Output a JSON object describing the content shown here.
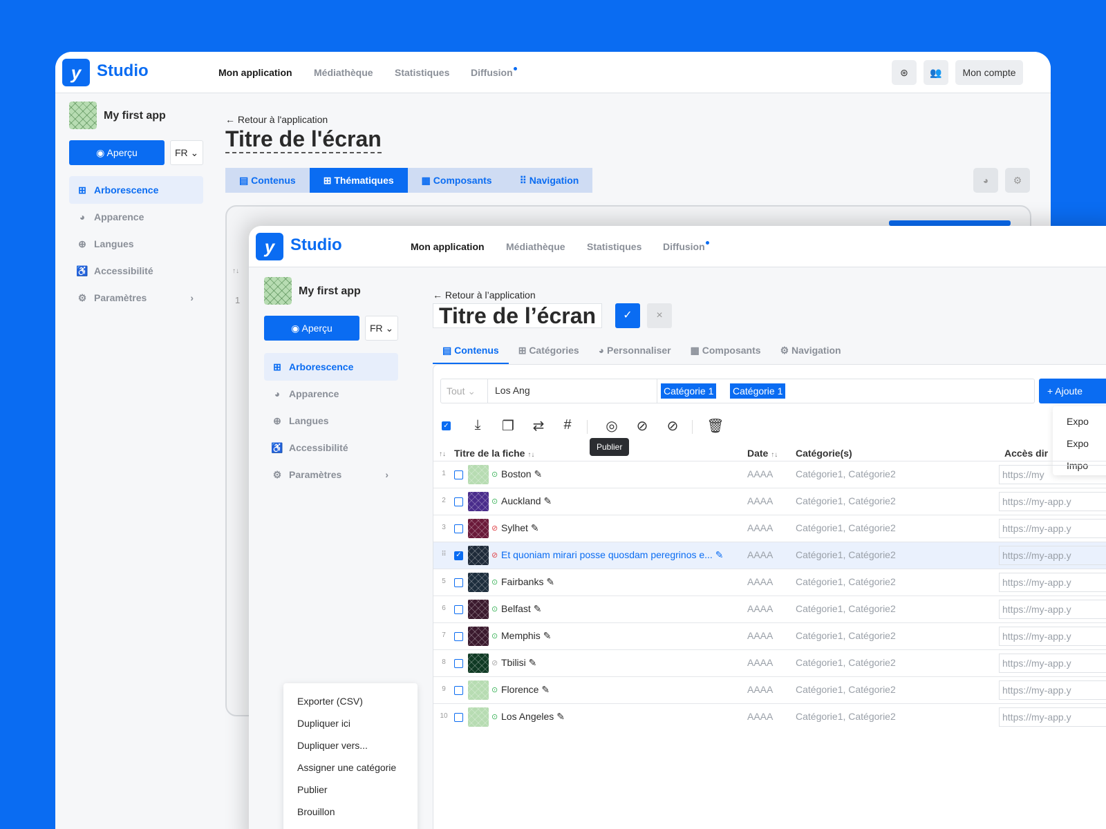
{
  "app": {
    "brand": "Studio",
    "nav": [
      "Mon application",
      "Médiathèque",
      "Statistiques",
      "Diffusion"
    ],
    "account": "Mon compte"
  },
  "sidebar": {
    "app_name": "My first app",
    "preview": "Aperçu",
    "lang": "FR",
    "items": [
      "Arborescence",
      "Apparence",
      "Langues",
      "Accessibilité",
      "Paramètres"
    ]
  },
  "back_window": {
    "back": "← Retour à l'application",
    "title": "Titre de l'écran",
    "tabs": [
      "Contenus",
      "Thématiques",
      "Composants",
      "Navigation"
    ],
    "row_marker": "1"
  },
  "front_window": {
    "back": "← Retour à l’application",
    "title": "Titre de l’écran",
    "tabs": [
      "Contenus",
      "Catégories",
      "Personnaliser",
      "Composants",
      "Navigation"
    ],
    "filter_select": "Tout",
    "filter_query": "Los Ang",
    "chips": [
      "Catégorie 1",
      "Catégorie 1"
    ],
    "add_button": "+ Ajoute",
    "tooltip": "Publier",
    "columns": [
      "Titre de la fiche",
      "Date",
      "Catégorie(s)",
      "Accès dir"
    ],
    "rows": [
      {
        "n": "1",
        "title": "Boston",
        "status": "published",
        "date": "AAAA",
        "cat": "Catégorie1, Catégorie2",
        "url": "https://my"
      },
      {
        "n": "2",
        "title": "Auckland",
        "status": "published",
        "date": "AAAA",
        "cat": "Catégorie1, Catégorie2",
        "url": "https://my-app.y"
      },
      {
        "n": "3",
        "title": "Sylhet",
        "status": "unpublished",
        "date": "AAAA",
        "cat": "Catégorie1, Catégorie2",
        "url": "https://my-app.y"
      },
      {
        "n": "",
        "title": "Et quoniam mirari posse quosdam peregrinos e...",
        "status": "unpublished",
        "date": "AAAA",
        "cat": "Catégorie1, Catégorie2",
        "url": "https://my-app.y"
      },
      {
        "n": "5",
        "title": "Fairbanks",
        "status": "published",
        "date": "AAAA",
        "cat": "Catégorie1, Catégorie2",
        "url": "https://my-app.y"
      },
      {
        "n": "6",
        "title": "Belfast",
        "status": "published",
        "date": "AAAA",
        "cat": "Catégorie1, Catégorie2",
        "url": "https://my-app.y"
      },
      {
        "n": "7",
        "title": "Memphis",
        "status": "published",
        "date": "AAAA",
        "cat": "Catégorie1, Catégorie2",
        "url": "https://my-app.y"
      },
      {
        "n": "8",
        "title": "Tbilisi",
        "status": "draft",
        "date": "AAAA",
        "cat": "Catégorie1, Catégorie2",
        "url": "https://my-app.y"
      },
      {
        "n": "9",
        "title": "Florence",
        "status": "published",
        "date": "AAAA",
        "cat": "Catégorie1, Catégorie2",
        "url": "https://my-app.y"
      },
      {
        "n": "10",
        "title": "Los Angeles",
        "status": "published",
        "date": "AAAA",
        "cat": "Catégorie1, Catégorie2",
        "url": "https://my-app.y"
      }
    ],
    "context_menu": [
      "Exporter (CSV)",
      "Dupliquer ici",
      "Dupliquer vers...",
      "Assigner une catégorie",
      "Publier",
      "Brouillon"
    ],
    "export_menu": [
      "Expo",
      "Expo",
      "Impo"
    ]
  },
  "colors": {
    "accent": "#0a6cf2",
    "published": "#3cb35a",
    "unpublished": "#e0474c"
  }
}
